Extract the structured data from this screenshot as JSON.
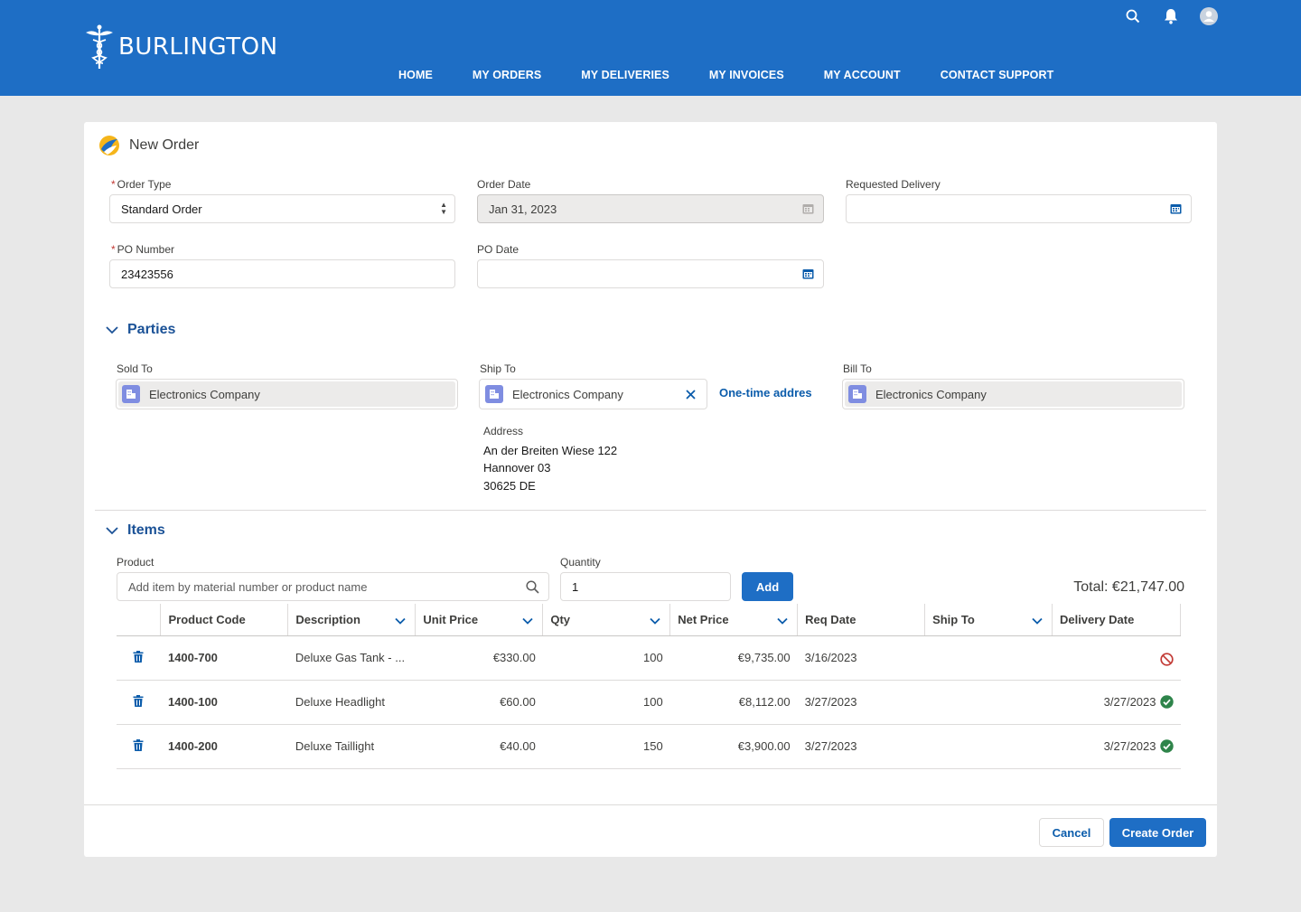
{
  "header": {
    "brand": "BURLINGTON",
    "nav": [
      "HOME",
      "MY ORDERS",
      "MY DELIVERIES",
      "MY INVOICES",
      "MY ACCOUNT",
      "CONTACT SUPPORT"
    ],
    "icons": [
      "search-icon",
      "bell-icon",
      "user-avatar-icon"
    ]
  },
  "page": {
    "title": "New Order"
  },
  "form": {
    "order_type": {
      "label": "Order Type",
      "value": "Standard Order",
      "required": "*"
    },
    "order_date": {
      "label": "Order Date",
      "value": "Jan 31, 2023"
    },
    "requested_delivery": {
      "label": "Requested Delivery",
      "value": ""
    },
    "po_number": {
      "label": "PO Number",
      "value": "23423556",
      "required": "*"
    },
    "po_date": {
      "label": "PO Date",
      "value": ""
    }
  },
  "parties": {
    "heading": "Parties",
    "sold_to": {
      "label": "Sold To",
      "value": "Electronics Company"
    },
    "ship_to": {
      "label": "Ship To",
      "value": "Electronics Company",
      "one_time_link": "One-time address"
    },
    "bill_to": {
      "label": "Bill To",
      "value": "Electronics Company"
    },
    "address": {
      "label": "Address",
      "line1": "An der Breiten Wiese 122",
      "line2": "Hannover 03",
      "line3": "30625 DE"
    }
  },
  "items": {
    "heading": "Items",
    "product_label": "Product",
    "product_placeholder": "Add item by material number or product name",
    "quantity_label": "Quantity",
    "quantity_value": "1",
    "add_label": "Add",
    "total": "Total: €21,747.00",
    "columns": [
      "Product Code",
      "Description",
      "Unit Price",
      "Qty",
      "Net Price",
      "Req Date",
      "Ship To",
      "Delivery Date"
    ],
    "rows": [
      {
        "code": "1400-700",
        "description": "Deluxe Gas Tank - ...",
        "unit_price": "€330.00",
        "qty": "100",
        "net_price": "€9,735.00",
        "req_date": "3/16/2023",
        "ship_to": "",
        "delivery_date": "",
        "status": "unavailable"
      },
      {
        "code": "1400-100",
        "description": "Deluxe Headlight",
        "unit_price": "€60.00",
        "qty": "100",
        "net_price": "€8,112.00",
        "req_date": "3/27/2023",
        "ship_to": "",
        "delivery_date": "3/27/2023",
        "status": "confirmed"
      },
      {
        "code": "1400-200",
        "description": "Deluxe Taillight",
        "unit_price": "€40.00",
        "qty": "150",
        "net_price": "€3,900.00",
        "req_date": "3/27/2023",
        "ship_to": "",
        "delivery_date": "3/27/2023",
        "status": "confirmed"
      }
    ]
  },
  "footer": {
    "cancel_label": "Cancel",
    "create_label": "Create Order"
  },
  "colors": {
    "header_blue": "#1e6ec5",
    "link_blue": "#0b5cab",
    "success_green": "#2e844a",
    "error_red": "#c23934"
  }
}
